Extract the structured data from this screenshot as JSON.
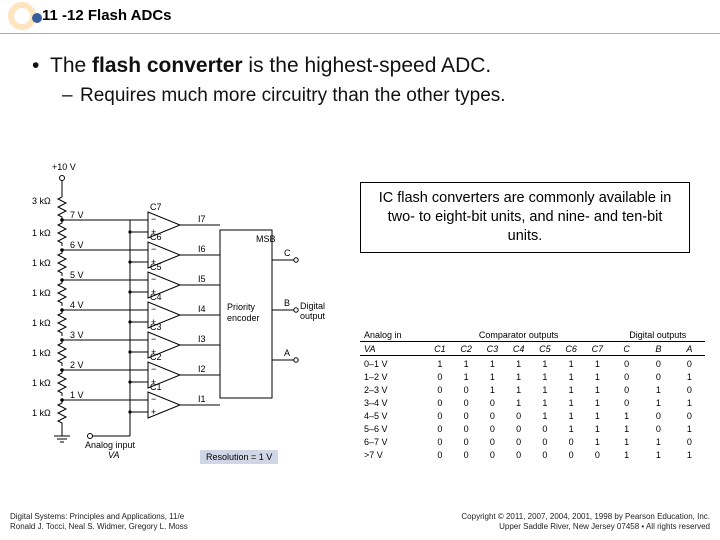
{
  "header": {
    "title": "11 -12 Flash ADCs"
  },
  "bullets": {
    "b1_pre": "The ",
    "b1_bold": "flash converter",
    "b1_post": " is the highest-speed ADC.",
    "b2": "Requires much more circuitry than the other types."
  },
  "infobox": "IC flash converters are commonly available in two- to eight-bit units, and nine- and ten-bit units.",
  "circuit": {
    "vsupply": "+10 V",
    "r_top": "3 kΩ",
    "r_other": "1 kΩ",
    "nodes": [
      "7 V",
      "6 V",
      "5 V",
      "4 V",
      "3 V",
      "2 V",
      "1 V"
    ],
    "comps": [
      "C7",
      "C6",
      "C5",
      "C4",
      "C3",
      "C2",
      "C1"
    ],
    "ilines": [
      "I7",
      "I6",
      "I5",
      "I4",
      "I3",
      "I2",
      "I1"
    ],
    "encoder": "Priority encoder",
    "msb": "MSB",
    "outs": [
      "C",
      "B",
      "A"
    ],
    "out_label": "Digital output",
    "analog_label": "Analog input",
    "va": "VA",
    "resolution": "Resolution = 1 V"
  },
  "table": {
    "head_groups": [
      "Analog in",
      "Comparator outputs",
      "Digital outputs"
    ],
    "cols": [
      "VA",
      "C1",
      "C2",
      "C3",
      "C4",
      "C5",
      "C6",
      "C7",
      "C",
      "B",
      "A"
    ],
    "rows": [
      [
        "0–1 V",
        "1",
        "1",
        "1",
        "1",
        "1",
        "1",
        "1",
        "0",
        "0",
        "0"
      ],
      [
        "1–2 V",
        "0",
        "1",
        "1",
        "1",
        "1",
        "1",
        "1",
        "0",
        "0",
        "1"
      ],
      [
        "2–3 V",
        "0",
        "0",
        "1",
        "1",
        "1",
        "1",
        "1",
        "0",
        "1",
        "0"
      ],
      [
        "3–4 V",
        "0",
        "0",
        "0",
        "1",
        "1",
        "1",
        "1",
        "0",
        "1",
        "1"
      ],
      [
        "4–5 V",
        "0",
        "0",
        "0",
        "0",
        "1",
        "1",
        "1",
        "1",
        "0",
        "0"
      ],
      [
        "5–6 V",
        "0",
        "0",
        "0",
        "0",
        "0",
        "1",
        "1",
        "1",
        "0",
        "1"
      ],
      [
        "6–7 V",
        "0",
        "0",
        "0",
        "0",
        "0",
        "0",
        "1",
        "1",
        "1",
        "0"
      ],
      [
        ">7 V",
        "0",
        "0",
        "0",
        "0",
        "0",
        "0",
        "0",
        "1",
        "1",
        "1"
      ]
    ]
  },
  "footer": {
    "left1": "Digital Systems: Principles and Applications, 11/e",
    "left2": "Ronald J. Tocci, Neal S. Widmer, Gregory L. Moss",
    "right1": "Copyright © 2011, 2007, 2004, 2001, 1998 by Pearson Education, Inc.",
    "right2": "Upper Saddle River, New Jersey 07458 • All rights reserved"
  }
}
